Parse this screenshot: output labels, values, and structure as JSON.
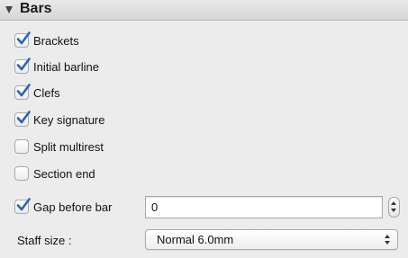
{
  "panel": {
    "title": "Bars"
  },
  "options": [
    {
      "label": "Brackets",
      "checked": true
    },
    {
      "label": "Initial barline",
      "checked": true
    },
    {
      "label": "Clefs",
      "checked": true
    },
    {
      "label": "Key signature",
      "checked": true
    },
    {
      "label": "Split multirest",
      "checked": false
    },
    {
      "label": "Section end",
      "checked": false
    }
  ],
  "gap": {
    "label": "Gap before bar",
    "checked": true,
    "value": "0"
  },
  "staff": {
    "label": "Staff size :",
    "selected": "Normal 6.0mm"
  },
  "colors": {
    "check": "#2b66b8",
    "header_bg": "#dcdcdc",
    "panel_bg": "#ececec"
  },
  "icons": {
    "disclosure": "disclosure-triangle-icon",
    "checkmark": "checkmark-icon",
    "stepper": "stepper-arrows-icon",
    "popup": "popup-arrows-icon"
  }
}
